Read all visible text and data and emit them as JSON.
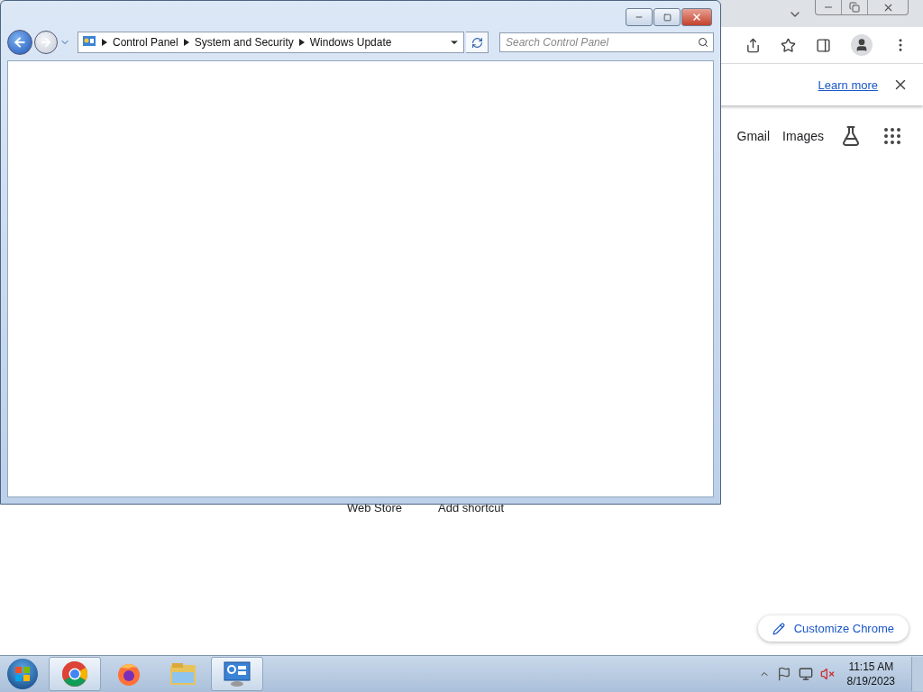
{
  "browser": {
    "infobar": {
      "link": "Learn more"
    },
    "header_links": [
      "Gmail",
      "Images"
    ],
    "shortcuts": [
      "Web Store",
      "Add shortcut"
    ],
    "customize_button": "Customize Chrome"
  },
  "explorer_window": {
    "breadcrumb": [
      "Control Panel",
      "System and Security",
      "Windows Update"
    ],
    "search": {
      "placeholder": "Search Control Panel"
    }
  },
  "taskbar": {
    "apps": [
      {
        "kind": "chrome",
        "selected": true
      },
      {
        "kind": "firefox",
        "selected": false
      },
      {
        "kind": "folder",
        "selected": false
      },
      {
        "kind": "control-panel",
        "selected": true
      }
    ],
    "clock": {
      "time": "11:15 AM",
      "date": "8/19/2023"
    }
  }
}
